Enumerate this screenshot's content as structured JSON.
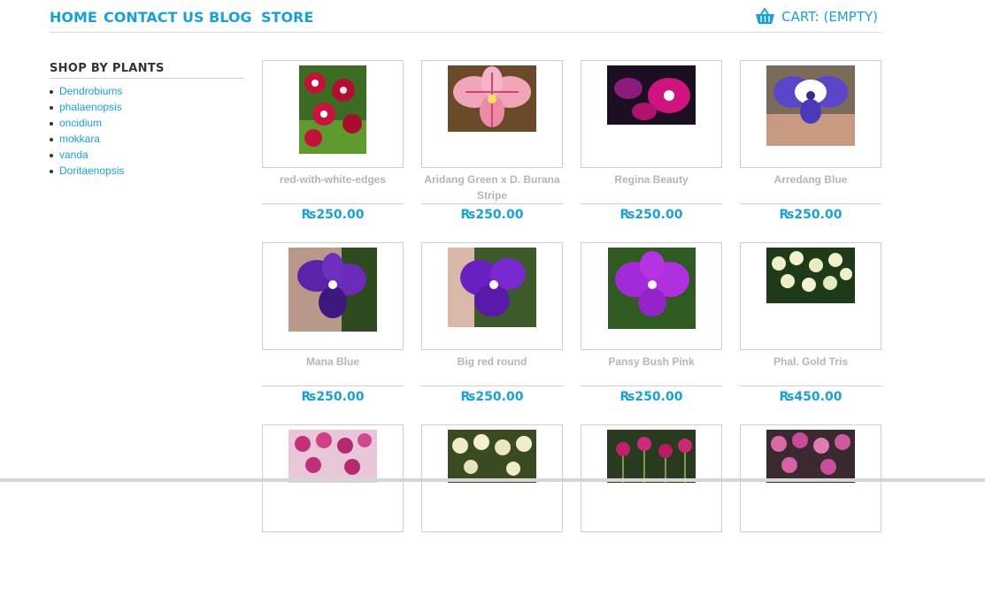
{
  "nav": {
    "home": "HOME",
    "contact": "CONTACT US",
    "blog": "BLOG",
    "store": "STORE",
    "cart": "CART: (EMPTY)"
  },
  "sidebar": {
    "heading": "SHOP BY PLANTS",
    "items": [
      "Dendrobiums",
      "phalaenopsis",
      "oncidium",
      "mokkara",
      "vanda",
      "Doritaenopsis"
    ]
  },
  "products": [
    {
      "name": "red-with-white-edges",
      "price": "₨250.00"
    },
    {
      "name": "Aridang Green x D. Burana Stripe",
      "price": "₨250.00"
    },
    {
      "name": "Regina Beauty",
      "price": "₨250.00"
    },
    {
      "name": "Arredang Blue",
      "price": "₨250.00"
    },
    {
      "name": "Mana Blue",
      "price": "₨250.00"
    },
    {
      "name": "Big red round",
      "price": "₨250.00"
    },
    {
      "name": "Pansy Bush Pink",
      "price": "₨250.00"
    },
    {
      "name": "Phal. Gold Tris",
      "price": "₨450.00"
    },
    {
      "name": "",
      "price": ""
    },
    {
      "name": "",
      "price": ""
    },
    {
      "name": "",
      "price": ""
    },
    {
      "name": "",
      "price": ""
    }
  ],
  "colors": {
    "accent": "#1aa0d8",
    "product_name": "#b5b5b5",
    "border": "#cfcfcf"
  }
}
